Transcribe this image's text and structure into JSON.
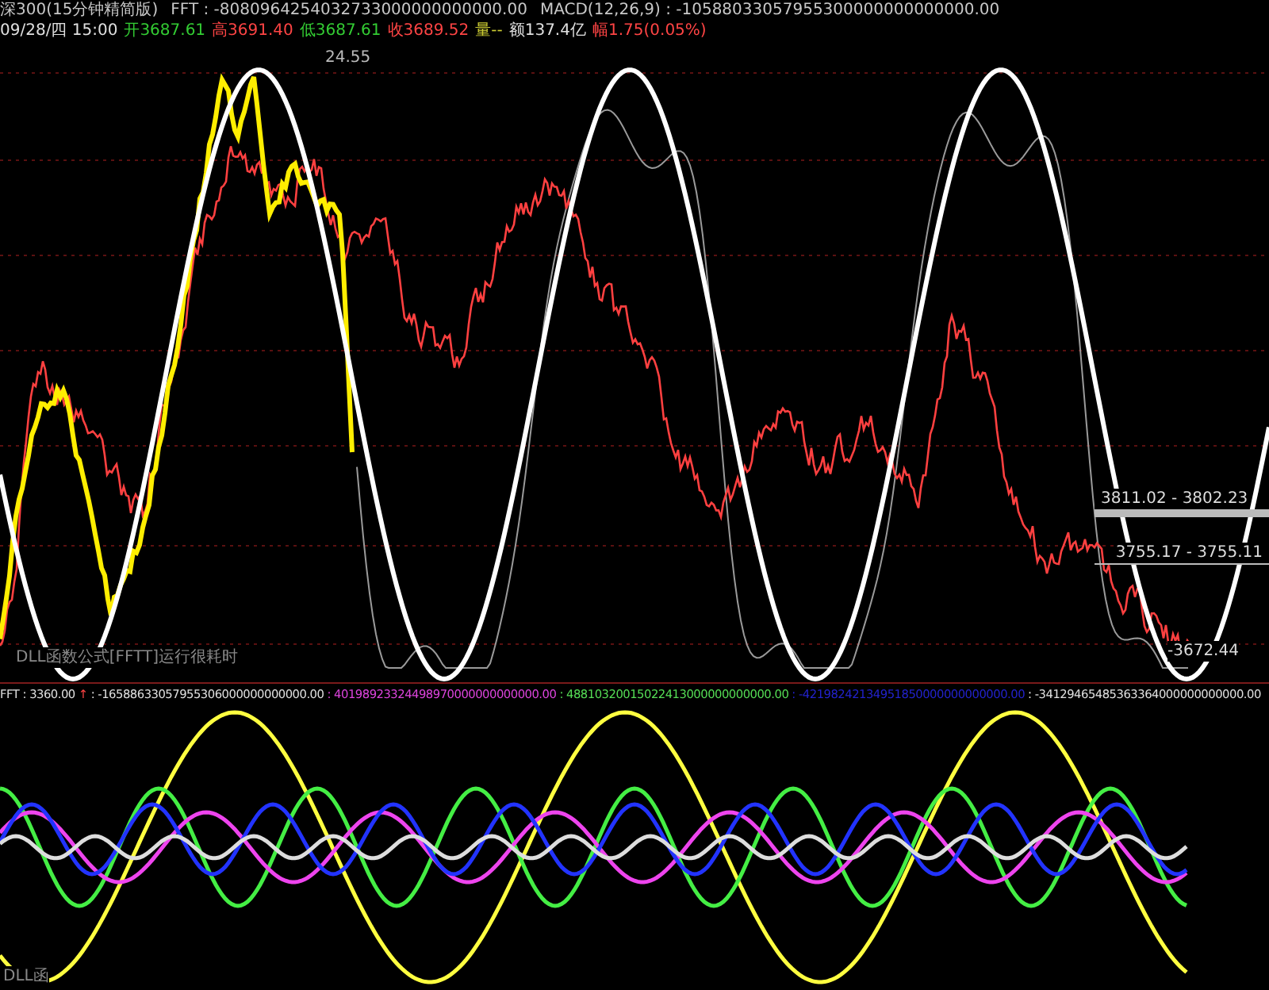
{
  "header": {
    "line_1": [
      {
        "text": "深300(15分钟精简版)",
        "color": "#c8c8c8"
      },
      {
        "text": "FFT : -8080964254032733000000000000.00",
        "color": "#c8c8c8"
      },
      {
        "text": "MACD(12,26,9) : -10588033057955300000000000000.00",
        "color": "#c8c8c8"
      }
    ],
    "line_2": [
      {
        "text": "09/28/四 15:00",
        "color": "#e0e0e0"
      },
      {
        "text": "开3687.61",
        "color": "#33cc33"
      },
      {
        "text": "高3691.40",
        "color": "#ff4444"
      },
      {
        "text": "低3687.61",
        "color": "#33cc33"
      },
      {
        "text": "收3689.52",
        "color": "#ff4444"
      },
      {
        "text": "量--",
        "color": "#cccc33"
      },
      {
        "text": "额137.4亿",
        "color": "#e0e0e0"
      },
      {
        "text": "幅1.75(0.05%)",
        "color": "#ff4444"
      }
    ]
  },
  "main_chart": {
    "high_label": "24.55",
    "notice": "DLL函数公式[FFTT]运行很耗时",
    "price_marks": [
      {
        "text": "3811.02 - 3802.23",
        "kind": "band"
      },
      {
        "text": "3755.17 - 3755.11",
        "kind": "line"
      },
      {
        "text": "-3672.44",
        "kind": "low"
      }
    ]
  },
  "fft_values": [
    {
      "text": "FFT : 3360.00",
      "color": "#e0e0e0"
    },
    {
      "text": "↑",
      "color": "#ff4444"
    },
    {
      "text": ": -16588633057955306000000000000.00",
      "color": "#e0e0e0"
    },
    {
      "text": ": 40198923324498970000000000000.00",
      "color": "#dd44dd"
    },
    {
      "text": ": 48810320015022413000000000000.00",
      "color": "#55dd55"
    },
    {
      "text": ": -42198242134951850000000000000.00",
      "color": "#2222cc"
    },
    {
      "text": ": -34129465485363364000000000000.00",
      "color": "#e0e0e0"
    }
  ],
  "footer_label": "DLL函"
}
